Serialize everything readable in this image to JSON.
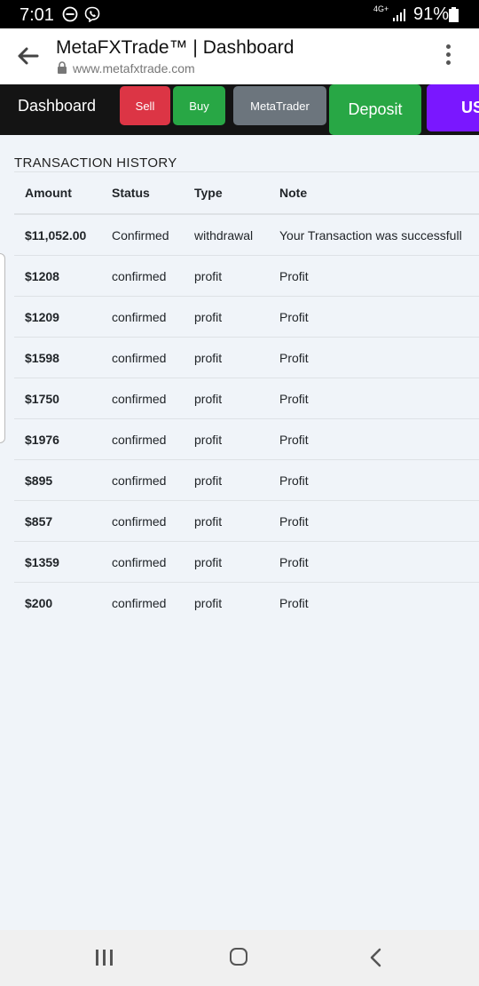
{
  "status_bar": {
    "time": "7:01",
    "network": "4G+",
    "battery_percent": "91%",
    "icons": [
      "do-not-disturb-icon",
      "viber-icon",
      "signal-icon",
      "battery-icon"
    ]
  },
  "browser": {
    "title": "MetaFXTrade™ | Dashboard",
    "url": "www.metafxtrade.com"
  },
  "nav": {
    "brand": "Dashboard",
    "sell": "Sell",
    "buy": "Buy",
    "metatrader": "MetaTrader",
    "deposit": "Deposit",
    "usd_partial": "US"
  },
  "transactions": {
    "title": "TRANSACTION HISTORY",
    "columns": [
      "Amount",
      "Status",
      "Type",
      "Note"
    ],
    "rows": [
      {
        "amount": "$11,052.00",
        "status": "Confirmed",
        "type": "withdrawal",
        "note": "Your Transaction was successfull"
      },
      {
        "amount": "$1208",
        "status": "confirmed",
        "type": "profit",
        "note": "Profit"
      },
      {
        "amount": "$1209",
        "status": "confirmed",
        "type": "profit",
        "note": "Profit"
      },
      {
        "amount": "$1598",
        "status": "confirmed",
        "type": "profit",
        "note": "Profit"
      },
      {
        "amount": "$1750",
        "status": "confirmed",
        "type": "profit",
        "note": "Profit"
      },
      {
        "amount": "$1976",
        "status": "confirmed",
        "type": "profit",
        "note": "Profit"
      },
      {
        "amount": "$895",
        "status": "confirmed",
        "type": "profit",
        "note": "Profit"
      },
      {
        "amount": "$857",
        "status": "confirmed",
        "type": "profit",
        "note": "Profit"
      },
      {
        "amount": "$1359",
        "status": "confirmed",
        "type": "profit",
        "note": "Profit"
      },
      {
        "amount": "$200",
        "status": "confirmed",
        "type": "profit",
        "note": "Profit"
      }
    ]
  },
  "colors": {
    "sell": "#dc3545",
    "buy": "#28a745",
    "metatrader": "#6c757d",
    "deposit": "#28a745",
    "usd": "#7a17ff",
    "navbar": "#141414",
    "page_bg": "#f0f4f9"
  }
}
